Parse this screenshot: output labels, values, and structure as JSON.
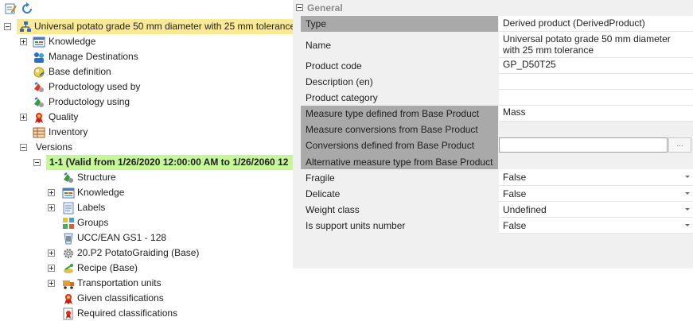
{
  "toolbar": {
    "edit_icon": "edit-note-icon",
    "refresh_icon": "refresh-icon"
  },
  "tree": {
    "root": {
      "label": "Universal potato grade 50 mm diameter with 25 mm tolerance",
      "icon": "hierarchy-icon"
    },
    "items": [
      {
        "label": "Knowledge",
        "icon": "knowledge-icon"
      },
      {
        "label": "Manage Destinations",
        "icon": "destinations-icon"
      },
      {
        "label": "Base definition",
        "icon": "base-definition-icon"
      },
      {
        "label": "Productology used by",
        "icon": "productology-used-by-icon"
      },
      {
        "label": "Productology using",
        "icon": "productology-using-icon"
      },
      {
        "label": "Quality",
        "icon": "quality-ribbon-icon"
      },
      {
        "label": "Inventory",
        "icon": "inventory-icon"
      },
      {
        "label": "Versions"
      }
    ],
    "version": {
      "label": "1-1 (Valid from 1/26/2020 12:00:00 AM to 1/26/2060 12"
    },
    "version_items": [
      {
        "label": "Structure",
        "icon": "structure-icon"
      },
      {
        "label": "Knowledge",
        "icon": "knowledge-icon"
      },
      {
        "label": "Labels",
        "icon": "labels-icon"
      },
      {
        "label": "Groups",
        "icon": "groups-icon"
      },
      {
        "label": "UCC/EAN  GS1 - 128",
        "icon": "barcode-cup-icon"
      },
      {
        "label": "20.P2 PotatoGraiding (Base)",
        "icon": "gear-icon"
      },
      {
        "label": "Recipe (Base)",
        "icon": "recipe-icon"
      },
      {
        "label": "Transportation units",
        "icon": "transport-icon"
      },
      {
        "label": "Given classifications",
        "icon": "classification-ribbon-icon"
      },
      {
        "label": "Required classifications",
        "icon": "required-classification-icon"
      }
    ]
  },
  "grid": {
    "category": "General",
    "rows": [
      {
        "key": "Type",
        "value": "Derived product (DerivedProduct)"
      },
      {
        "key": "Name",
        "value": "Universal potato grade 50 mm diameter with 25 mm tolerance"
      },
      {
        "key": "Product code",
        "value": "GP_D50T25"
      },
      {
        "key": "Description (en)",
        "value": ""
      },
      {
        "key": "Product category",
        "value": ""
      },
      {
        "key": "Measure type defined from Base Product",
        "value": "Mass"
      },
      {
        "key": "Measure conversions from Base Product",
        "value": ""
      },
      {
        "key": "Conversions defined from Base Product",
        "value": "",
        "button": "..."
      },
      {
        "key": "Alternative measure type from Base Product",
        "value": ""
      },
      {
        "key": "Fragile",
        "value": "False"
      },
      {
        "key": "Delicate",
        "value": "False"
      },
      {
        "key": "Weight class",
        "value": "Undefined"
      },
      {
        "key": "Is support units number",
        "value": "False"
      }
    ]
  },
  "colors": {
    "root_highlight": "#fbe995",
    "version_highlight": "#c7f59a",
    "readonly_key": "#a9a9a9",
    "grid_bg": "#f0f0f0"
  }
}
